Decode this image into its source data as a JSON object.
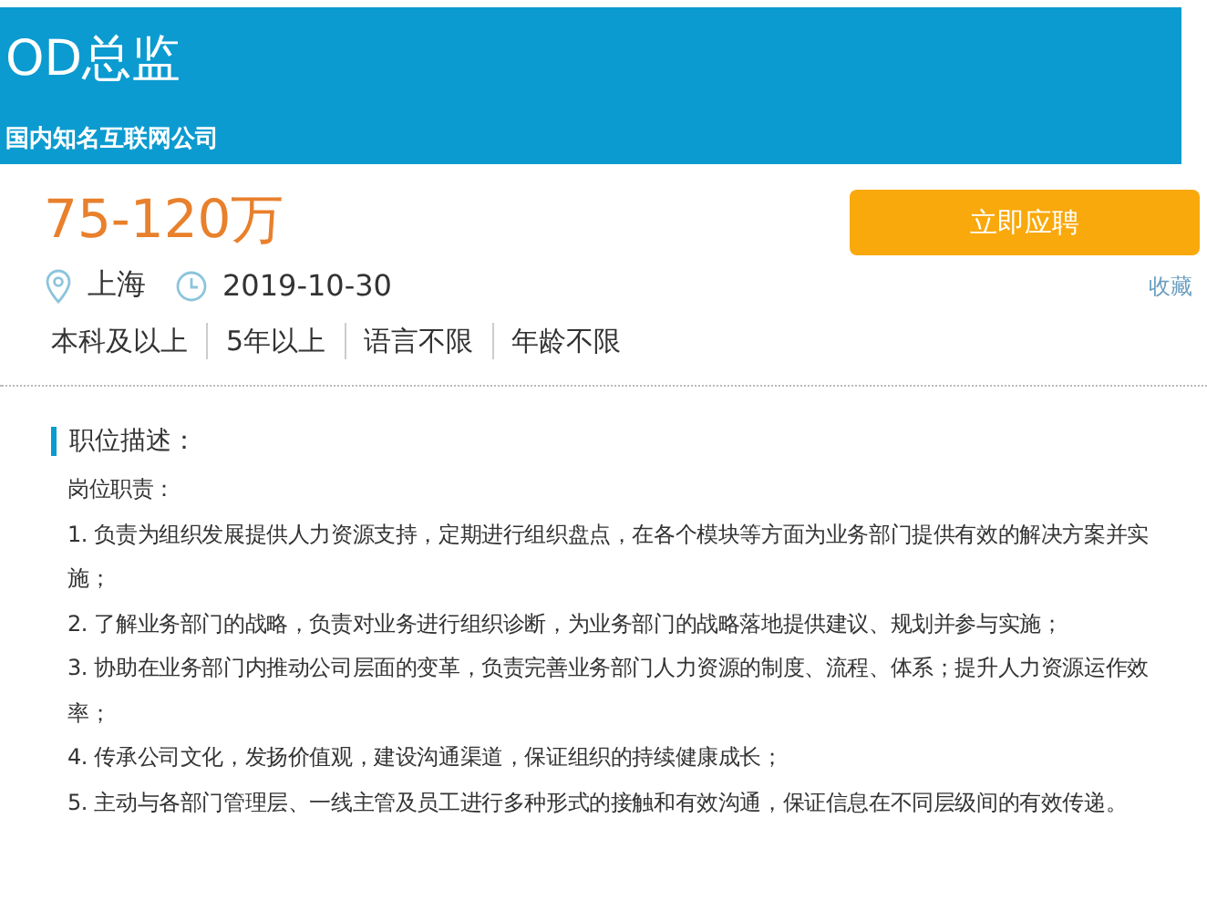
{
  "header": {
    "title": "OD总监",
    "company": "国内知名互联网公司"
  },
  "salary": "75-120万",
  "apply_button": "立即应聘",
  "favorite_link": "收藏",
  "location": "上海",
  "date": "2019-10-30",
  "requirements": [
    "本科及以上",
    "5年以上",
    "语言不限",
    "年龄不限"
  ],
  "description": {
    "heading": "职位描述：",
    "subheading": "岗位职责：",
    "items": [
      "1. 负责为组织发展提供人力资源支持，定期进行组织盘点，在各个模块等方面为业务部门提供有效的解决方案并实施；",
      "2. 了解业务部门的战略，负责对业务进行组织诊断，为业务部门的战略落地提供建议、规划并参与实施；",
      "3. 协助在业务部门内推动公司层面的变革，负责完善业务部门人力资源的制度、流程、体系；提升人力资源运作效率；",
      "4. 传承公司文化，发扬价值观，建设沟通渠道，保证组织的持续健康成长；",
      "5. 主动与各部门管理层、一线主管及员工进行多种形式的接触和有效沟通，保证信息在不同层级间的有效传递。"
    ]
  }
}
